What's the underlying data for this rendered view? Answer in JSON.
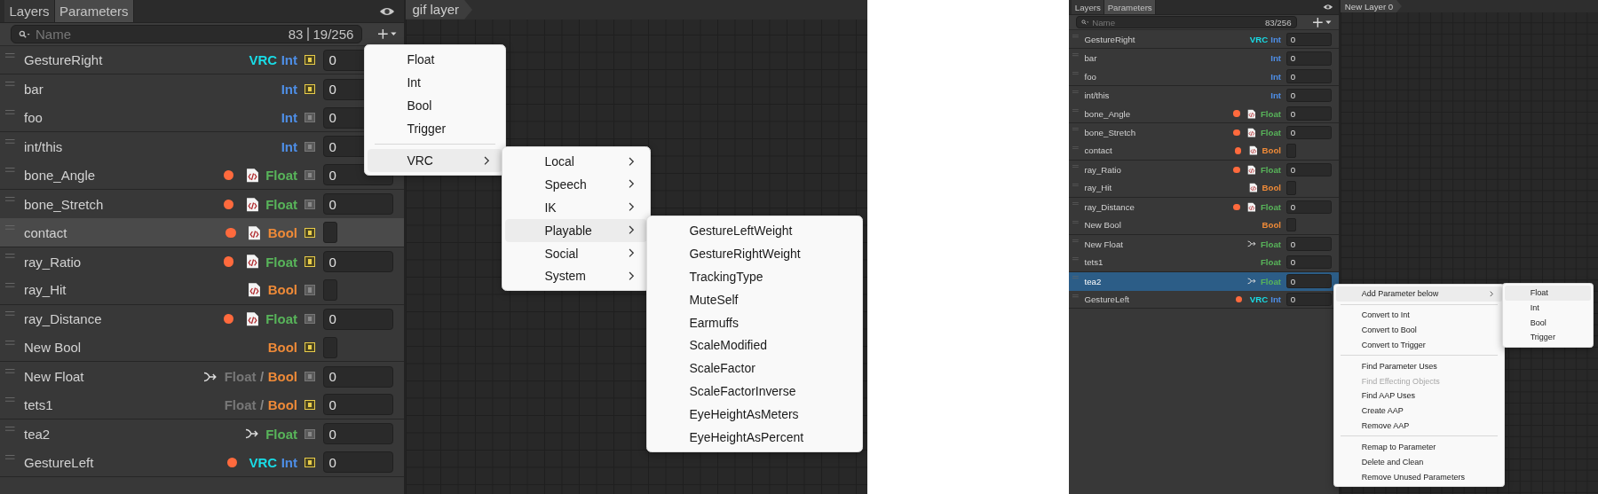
{
  "screens": [
    {
      "focused": false,
      "tabs": [
        {
          "label": "Layers",
          "selected": false
        },
        {
          "label": "Parameters",
          "selected": true
        }
      ],
      "search": {
        "placeholder": "Name",
        "counts": [
          "83",
          "19/256"
        ]
      },
      "graph_tab": "gif layer",
      "parameters": [
        {
          "name": "GestureRight",
          "dot": false,
          "code_icon": false,
          "link_icon": false,
          "types": [
            {
              "text": "VRC",
              "kind": "vrc"
            },
            {
              "text": "Int",
              "kind": "int"
            }
          ],
          "saved": true,
          "value": "0",
          "selected": false
        },
        {
          "name": "bar",
          "dot": false,
          "code_icon": false,
          "link_icon": false,
          "types": [
            {
              "text": "Int",
              "kind": "int"
            }
          ],
          "saved": true,
          "value": "0",
          "selected": false
        },
        {
          "name": "foo",
          "dot": false,
          "code_icon": false,
          "link_icon": false,
          "types": [
            {
              "text": "Int",
              "kind": "int"
            }
          ],
          "saved": false,
          "value": "0",
          "selected": false
        },
        {
          "name": "int/this",
          "dot": false,
          "code_icon": false,
          "link_icon": false,
          "types": [
            {
              "text": "Int",
              "kind": "int"
            }
          ],
          "saved": false,
          "value": "0",
          "selected": false
        },
        {
          "name": "bone_Angle",
          "dot": true,
          "code_icon": true,
          "link_icon": false,
          "types": [
            {
              "text": "Float",
              "kind": "float"
            }
          ],
          "saved": false,
          "value": "0",
          "selected": false
        },
        {
          "name": "bone_Stretch",
          "dot": true,
          "code_icon": true,
          "link_icon": false,
          "types": [
            {
              "text": "Float",
              "kind": "float"
            }
          ],
          "saved": false,
          "value": "0",
          "selected": false
        },
        {
          "name": "contact",
          "dot": true,
          "code_icon": true,
          "link_icon": false,
          "types": [
            {
              "text": "Bool",
              "kind": "bool"
            }
          ],
          "saved": true,
          "checked": false,
          "selected": true
        },
        {
          "name": "ray_Ratio",
          "dot": true,
          "code_icon": true,
          "link_icon": false,
          "types": [
            {
              "text": "Float",
              "kind": "float"
            }
          ],
          "saved": true,
          "value": "0",
          "selected": false
        },
        {
          "name": "ray_Hit",
          "dot": false,
          "code_icon": true,
          "link_icon": false,
          "types": [
            {
              "text": "Bool",
              "kind": "bool"
            }
          ],
          "saved": false,
          "checked": false,
          "selected": false
        },
        {
          "name": "ray_Distance",
          "dot": true,
          "code_icon": true,
          "link_icon": false,
          "types": [
            {
              "text": "Float",
              "kind": "float"
            }
          ],
          "saved": false,
          "value": "0",
          "selected": false
        },
        {
          "name": "New Bool",
          "dot": false,
          "code_icon": false,
          "link_icon": false,
          "types": [
            {
              "text": "Bool",
              "kind": "bool"
            }
          ],
          "saved": true,
          "checked": false,
          "selected": false
        },
        {
          "name": "New Float",
          "dot": false,
          "code_icon": false,
          "link_icon": true,
          "types": [
            {
              "text": "Float",
              "kind": "inactive"
            },
            {
              "text": "/",
              "kind": "sep"
            },
            {
              "text": "Bool",
              "kind": "bool"
            }
          ],
          "saved": false,
          "value": "0",
          "selected": false
        },
        {
          "name": "tets1",
          "dot": false,
          "code_icon": false,
          "link_icon": false,
          "types": [
            {
              "text": "Float",
              "kind": "inactive"
            },
            {
              "text": "/",
              "kind": "sep"
            },
            {
              "text": "Bool",
              "kind": "bool"
            }
          ],
          "saved": true,
          "value": "0",
          "selected": false
        },
        {
          "name": "tea2",
          "dot": false,
          "code_icon": false,
          "link_icon": true,
          "types": [
            {
              "text": "Float",
              "kind": "float"
            }
          ],
          "saved": false,
          "value": "0",
          "selected": false
        },
        {
          "name": "GestureLeft",
          "dot": true,
          "code_icon": false,
          "link_icon": false,
          "types": [
            {
              "text": "VRC",
              "kind": "vrc"
            },
            {
              "text": "Int",
              "kind": "int"
            }
          ],
          "saved": true,
          "value": "0",
          "selected": false
        }
      ],
      "menus": [
        {
          "items": [
            {
              "kind": "item",
              "label": "Float",
              "submenu": false,
              "selected": false
            },
            {
              "kind": "item",
              "label": "Int",
              "submenu": false,
              "selected": false
            },
            {
              "kind": "item",
              "label": "Bool",
              "submenu": false,
              "selected": false
            },
            {
              "kind": "item",
              "label": "Trigger",
              "submenu": false,
              "selected": false
            },
            {
              "kind": "separator"
            },
            {
              "kind": "item",
              "label": "VRC",
              "submenu": true,
              "selected": true
            }
          ]
        },
        {
          "items": [
            {
              "kind": "item",
              "label": "Local",
              "submenu": true,
              "selected": false
            },
            {
              "kind": "item",
              "label": "Speech",
              "submenu": true,
              "selected": false
            },
            {
              "kind": "item",
              "label": "IK",
              "submenu": true,
              "selected": false
            },
            {
              "kind": "item",
              "label": "Playable",
              "submenu": true,
              "selected": true
            },
            {
              "kind": "item",
              "label": "Social",
              "submenu": true,
              "selected": false
            },
            {
              "kind": "item",
              "label": "System",
              "submenu": true,
              "selected": false
            }
          ]
        },
        {
          "items": [
            {
              "kind": "item",
              "label": "GestureLeftWeight",
              "submenu": false,
              "selected": false
            },
            {
              "kind": "item",
              "label": "GestureRightWeight",
              "submenu": false,
              "selected": false
            },
            {
              "kind": "item",
              "label": "TrackingType",
              "submenu": false,
              "selected": false
            },
            {
              "kind": "item",
              "label": "MuteSelf",
              "submenu": false,
              "selected": false
            },
            {
              "kind": "item",
              "label": "Earmuffs",
              "submenu": false,
              "selected": false
            },
            {
              "kind": "item",
              "label": "ScaleModified",
              "submenu": false,
              "selected": false
            },
            {
              "kind": "item",
              "label": "ScaleFactor",
              "submenu": false,
              "selected": false
            },
            {
              "kind": "item",
              "label": "ScaleFactorInverse",
              "submenu": false,
              "selected": false
            },
            {
              "kind": "item",
              "label": "EyeHeightAsMeters",
              "submenu": false,
              "selected": false
            },
            {
              "kind": "item",
              "label": "EyeHeightAsPercent",
              "submenu": false,
              "selected": false
            }
          ]
        }
      ]
    },
    {
      "focused": true,
      "tabs": [
        {
          "label": "Layers",
          "selected": false
        },
        {
          "label": "Parameters",
          "selected": true
        }
      ],
      "search": {
        "placeholder": "Name",
        "counts": [
          "83/256"
        ]
      },
      "graph_tab": "New Layer 0",
      "parameters": [
        {
          "name": "GestureRight",
          "dot": false,
          "code_icon": false,
          "link_icon": false,
          "types": [
            {
              "text": "VRC",
              "kind": "vrc"
            },
            {
              "text": "Int",
              "kind": "int"
            }
          ],
          "value": "0",
          "selected": false
        },
        {
          "name": "bar",
          "dot": false,
          "code_icon": false,
          "link_icon": false,
          "types": [
            {
              "text": "Int",
              "kind": "int"
            }
          ],
          "value": "0",
          "selected": false
        },
        {
          "name": "foo",
          "dot": false,
          "code_icon": false,
          "link_icon": false,
          "types": [
            {
              "text": "Int",
              "kind": "int"
            }
          ],
          "value": "0",
          "selected": false
        },
        {
          "name": "int/this",
          "dot": false,
          "code_icon": false,
          "link_icon": false,
          "types": [
            {
              "text": "Int",
              "kind": "int"
            }
          ],
          "value": "0",
          "selected": false
        },
        {
          "name": "bone_Angle",
          "dot": true,
          "code_icon": true,
          "link_icon": false,
          "types": [
            {
              "text": "Float",
              "kind": "float"
            }
          ],
          "value": "0",
          "selected": false
        },
        {
          "name": "bone_Stretch",
          "dot": true,
          "code_icon": true,
          "link_icon": false,
          "types": [
            {
              "text": "Float",
              "kind": "float"
            }
          ],
          "value": "0",
          "selected": false
        },
        {
          "name": "contact",
          "dot": true,
          "code_icon": true,
          "link_icon": false,
          "types": [
            {
              "text": "Bool",
              "kind": "bool"
            }
          ],
          "checked": false,
          "selected": false
        },
        {
          "name": "ray_Ratio",
          "dot": true,
          "code_icon": true,
          "link_icon": false,
          "types": [
            {
              "text": "Float",
              "kind": "float"
            }
          ],
          "value": "0",
          "selected": false
        },
        {
          "name": "ray_Hit",
          "dot": false,
          "code_icon": true,
          "link_icon": false,
          "types": [
            {
              "text": "Bool",
              "kind": "bool"
            }
          ],
          "checked": false,
          "selected": false
        },
        {
          "name": "ray_Distance",
          "dot": true,
          "code_icon": true,
          "link_icon": false,
          "types": [
            {
              "text": "Float",
              "kind": "float"
            }
          ],
          "value": "0",
          "selected": false
        },
        {
          "name": "New Bool",
          "dot": false,
          "code_icon": false,
          "link_icon": false,
          "types": [
            {
              "text": "Bool",
              "kind": "bool"
            }
          ],
          "checked": false,
          "selected": false
        },
        {
          "name": "New Float",
          "dot": false,
          "code_icon": false,
          "link_icon": true,
          "types": [
            {
              "text": "Float",
              "kind": "float"
            }
          ],
          "value": "0",
          "selected": false
        },
        {
          "name": "tets1",
          "dot": false,
          "code_icon": false,
          "link_icon": false,
          "types": [
            {
              "text": "Float",
              "kind": "float"
            }
          ],
          "value": "0",
          "selected": false
        },
        {
          "name": "tea2",
          "dot": false,
          "code_icon": false,
          "link_icon": true,
          "types": [
            {
              "text": "Float",
              "kind": "float"
            }
          ],
          "value": "0",
          "selected": true
        },
        {
          "name": "GestureLeft",
          "dot": true,
          "code_icon": false,
          "link_icon": false,
          "types": [
            {
              "text": "VRC",
              "kind": "vrc"
            },
            {
              "text": "Int",
              "kind": "int"
            }
          ],
          "value": "0",
          "selected": false
        }
      ],
      "menus": [
        {
          "items": [
            {
              "kind": "item",
              "label": "Add Parameter below",
              "submenu": true,
              "selected": true,
              "disabled": false
            },
            {
              "kind": "separator"
            },
            {
              "kind": "item",
              "label": "Convert to Int",
              "submenu": false,
              "selected": false,
              "disabled": false
            },
            {
              "kind": "item",
              "label": "Convert to Bool",
              "submenu": false,
              "selected": false,
              "disabled": false
            },
            {
              "kind": "item",
              "label": "Convert to Trigger",
              "submenu": false,
              "selected": false,
              "disabled": false
            },
            {
              "kind": "separator"
            },
            {
              "kind": "item",
              "label": "Find Parameter Uses",
              "submenu": false,
              "selected": false,
              "disabled": false
            },
            {
              "kind": "item",
              "label": "Find Effecting Objects",
              "submenu": false,
              "selected": false,
              "disabled": true
            },
            {
              "kind": "item",
              "label": "Find AAP Uses",
              "submenu": false,
              "selected": false,
              "disabled": false
            },
            {
              "kind": "item",
              "label": "Create AAP",
              "submenu": false,
              "selected": false,
              "disabled": false
            },
            {
              "kind": "item",
              "label": "Remove AAP",
              "submenu": false,
              "selected": false,
              "disabled": false
            },
            {
              "kind": "separator"
            },
            {
              "kind": "item",
              "label": "Remap to Parameter",
              "submenu": false,
              "selected": false,
              "disabled": false
            },
            {
              "kind": "item",
              "label": "Delete and Clean",
              "submenu": false,
              "selected": false,
              "disabled": false
            },
            {
              "kind": "item",
              "label": "Remove Unused Parameters",
              "submenu": false,
              "selected": false,
              "disabled": false
            }
          ]
        },
        {
          "items": [
            {
              "kind": "item",
              "label": "Float",
              "submenu": false,
              "selected": true
            },
            {
              "kind": "item",
              "label": "Int",
              "submenu": false,
              "selected": false
            },
            {
              "kind": "item",
              "label": "Bool",
              "submenu": false,
              "selected": false
            },
            {
              "kind": "item",
              "label": "Trigger",
              "submenu": false,
              "selected": false
            }
          ]
        }
      ]
    }
  ]
}
